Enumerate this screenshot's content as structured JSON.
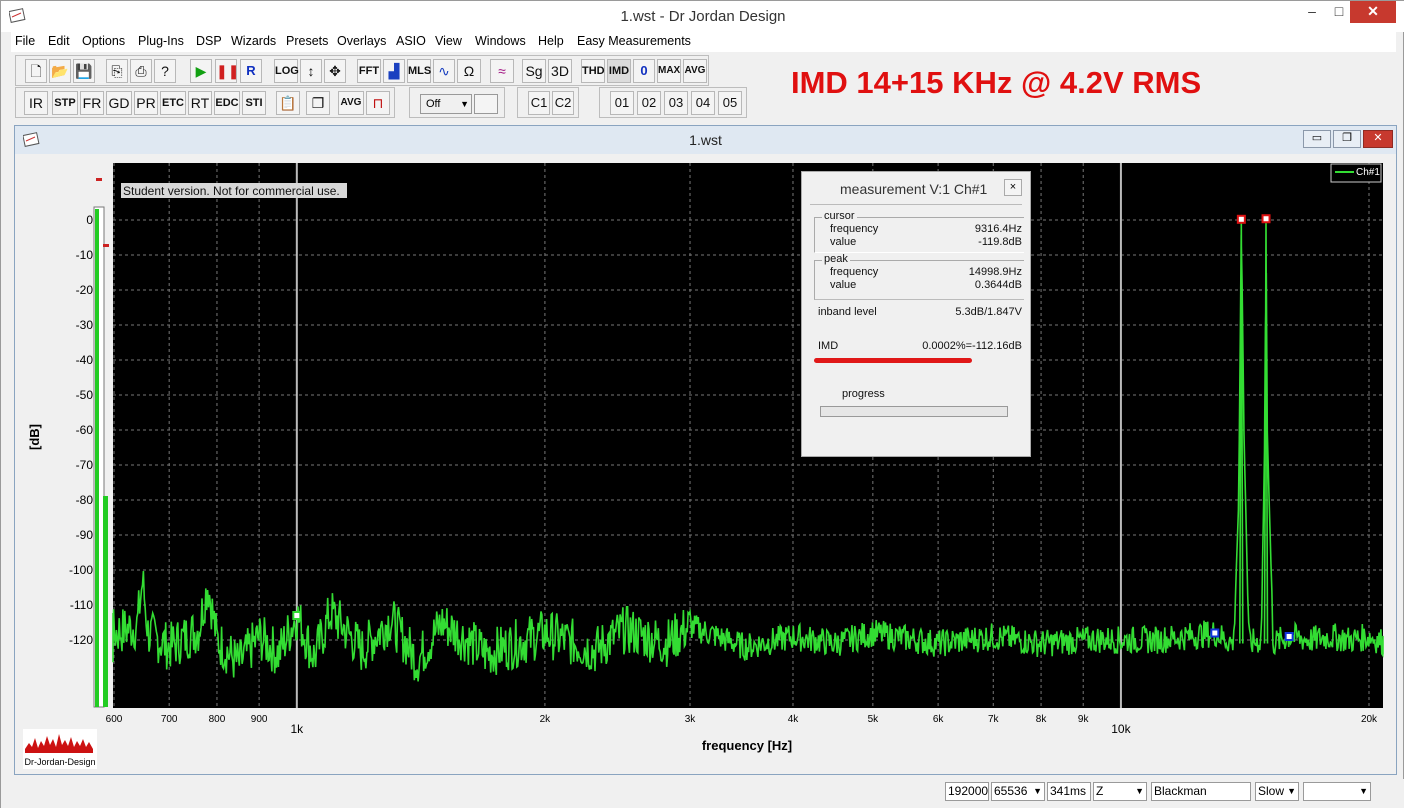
{
  "window": {
    "title": "1.wst - Dr Jordan Design"
  },
  "menu": [
    "File",
    "Edit",
    "Options",
    "Plug-Ins",
    "DSP",
    "Wizards",
    "Presets",
    "Overlays",
    "ASIO",
    "View",
    "Windows",
    "Help",
    "Easy Measurements"
  ],
  "toolbar1": {
    "buttons": [
      "LOG",
      "FFT",
      "MLS",
      "Sg",
      "3D",
      "THD",
      "IMD",
      "0",
      "MAX",
      "AVG"
    ]
  },
  "toolbar2": {
    "buttons": [
      "IR",
      "STP",
      "FR",
      "GD",
      "PR",
      "ETC",
      "RT",
      "EDC",
      "STI",
      "AVG"
    ],
    "select_value": "Off",
    "channel_buttons": [
      "C1",
      "C2"
    ],
    "preset_buttons": [
      "01",
      "02",
      "03",
      "04",
      "05"
    ]
  },
  "annotation": "IMD 14+15 KHz @ 4.2V RMS",
  "child": {
    "title": "1.wst"
  },
  "plot": {
    "notice": "Student version. Not for commercial use.",
    "legend": "Ch#1",
    "ylabel": "[dB]",
    "xlabel": "frequency [Hz]",
    "logo": "Dr-Jordan-Design"
  },
  "measurement": {
    "title": "measurement V:1 Ch#1",
    "close": "×",
    "cursor_label": "cursor",
    "cursor_freq_label": "frequency",
    "cursor_freq": "9316.4Hz",
    "cursor_val_label": "value",
    "cursor_val": "-119.8dB",
    "peak_label": "peak",
    "peak_freq_label": "frequency",
    "peak_freq": "14998.9Hz",
    "peak_val_label": "value",
    "peak_val": "0.3644dB",
    "inband_label": "inband level",
    "inband_val": "5.3dB/1.847V",
    "imd_label": "IMD",
    "imd_val": "0.0002%=-112.16dB",
    "progress_label": "progress"
  },
  "status": {
    "rate": "192000",
    "fft": "65536",
    "time": "341ms",
    "z": "Z",
    "window": "Blackman",
    "speed": "Slow",
    "extra": ""
  },
  "chart_data": {
    "type": "line",
    "xlabel": "frequency [Hz]",
    "ylabel": "[dB]",
    "xscale": "log",
    "xlim": [
      550,
      21000
    ],
    "ylim": [
      -130,
      5
    ],
    "y_ticks": [
      0,
      -10,
      -20,
      -30,
      -40,
      -50,
      -60,
      -70,
      -80,
      -90,
      -100,
      -110,
      -120
    ],
    "x_ticks": [
      {
        "v": 600,
        "l": "600"
      },
      {
        "v": 700,
        "l": "700"
      },
      {
        "v": 800,
        "l": "800"
      },
      {
        "v": 900,
        "l": "900"
      },
      {
        "v": 1000,
        "l": "1k"
      },
      {
        "v": 2000,
        "l": "2k"
      },
      {
        "v": 3000,
        "l": "3k"
      },
      {
        "v": 4000,
        "l": "4k"
      },
      {
        "v": 5000,
        "l": "5k"
      },
      {
        "v": 6000,
        "l": "6k"
      },
      {
        "v": 7000,
        "l": "7k"
      },
      {
        "v": 8000,
        "l": "8k"
      },
      {
        "v": 9000,
        "l": "9k"
      },
      {
        "v": 10000,
        "l": "10k"
      },
      {
        "v": 20000,
        "l": "20k"
      }
    ],
    "grid": true,
    "legend_position": "top-right",
    "series": [
      {
        "name": "Ch#1",
        "color": "#33dd33",
        "noise_floor_db": -120,
        "points": [
          [
            550,
            -121
          ],
          [
            600,
            -118
          ],
          [
            640,
            -116
          ],
          [
            650,
            -103
          ],
          [
            660,
            -118
          ],
          [
            700,
            -122
          ],
          [
            760,
            -117
          ],
          [
            780,
            -104
          ],
          [
            800,
            -120
          ],
          [
            850,
            -127
          ],
          [
            900,
            -119
          ],
          [
            950,
            -124
          ],
          [
            1000,
            -113
          ],
          [
            1050,
            -125
          ],
          [
            1100,
            -112
          ],
          [
            1200,
            -123
          ],
          [
            1300,
            -114
          ],
          [
            1400,
            -126
          ],
          [
            1500,
            -115
          ],
          [
            1700,
            -124
          ],
          [
            2000,
            -118
          ],
          [
            2300,
            -123
          ],
          [
            2500,
            -117
          ],
          [
            2800,
            -121
          ],
          [
            3000,
            -116
          ],
          [
            3500,
            -122
          ],
          [
            4000,
            -119
          ],
          [
            4500,
            -121
          ],
          [
            5000,
            -118
          ],
          [
            6000,
            -121
          ],
          [
            7000,
            -119
          ],
          [
            8000,
            -121
          ],
          [
            9316,
            -119.8
          ],
          [
            10000,
            -120
          ],
          [
            11000,
            -120
          ],
          [
            12000,
            -119
          ],
          [
            13000,
            -118
          ],
          [
            13700,
            -121
          ],
          [
            13900,
            -80
          ],
          [
            14000,
            0.2
          ],
          [
            14100,
            -60
          ],
          [
            14300,
            -121
          ],
          [
            14800,
            -120
          ],
          [
            14950,
            -60
          ],
          [
            15000,
            0.36
          ],
          [
            15050,
            -60
          ],
          [
            15300,
            -121
          ],
          [
            16000,
            -119
          ],
          [
            17000,
            -120
          ],
          [
            18000,
            -119
          ],
          [
            19000,
            -120
          ],
          [
            20000,
            -119
          ],
          [
            21000,
            -121
          ]
        ],
        "markers": [
          {
            "f": 14000,
            "db": 0.2,
            "kind": "peak"
          },
          {
            "f": 15000,
            "db": 0.36,
            "kind": "peak"
          },
          {
            "f": 13000,
            "db": -118,
            "kind": "harmonic"
          },
          {
            "f": 16000,
            "db": -119,
            "kind": "harmonic"
          },
          {
            "f": 1000,
            "db": -113,
            "kind": "cursor"
          }
        ]
      }
    ]
  }
}
